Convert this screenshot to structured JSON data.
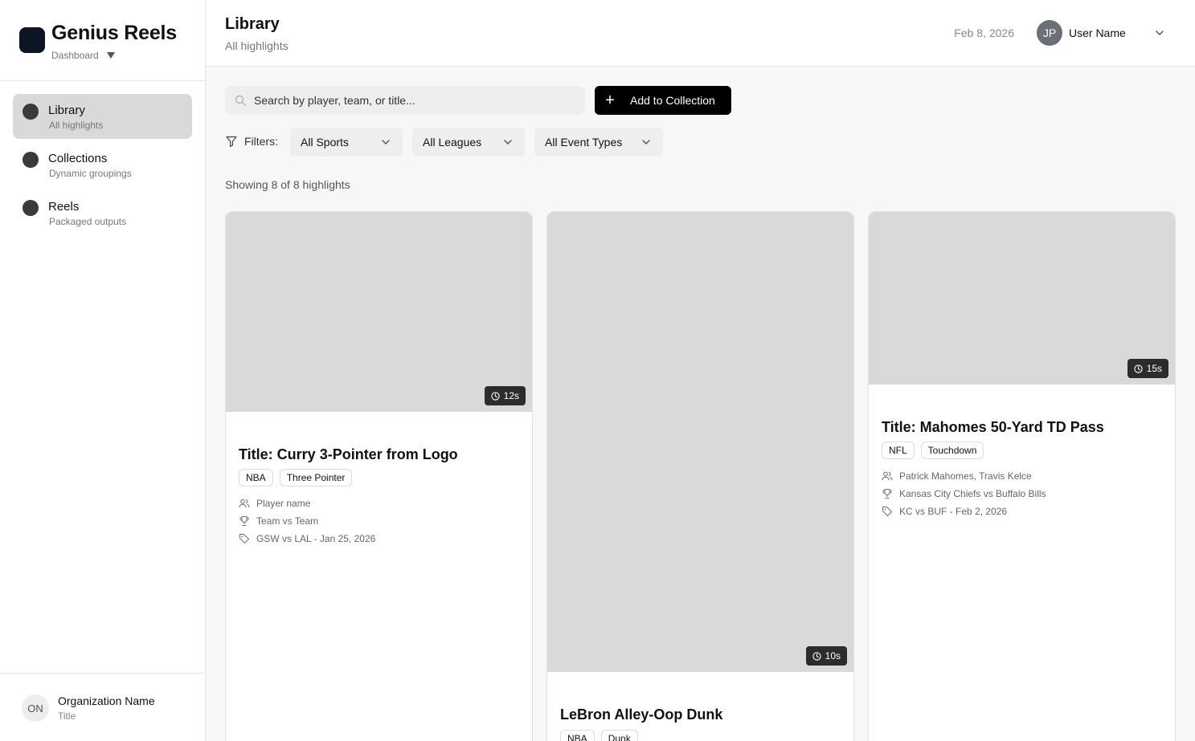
{
  "app": {
    "name": "Genius Reels",
    "context": "Dashboard"
  },
  "sidebar": {
    "items": [
      {
        "label": "Library",
        "sub": "All highlights"
      },
      {
        "label": "Collections",
        "sub": "Dynamic groupings"
      },
      {
        "label": "Reels",
        "sub": "Packaged outputs"
      }
    ],
    "org": {
      "initials": "ON",
      "name": "Organization Name",
      "title": "Title"
    }
  },
  "header": {
    "title": "Library",
    "subtitle": "All highlights",
    "date": "Feb 8, 2026",
    "user": {
      "initials": "JP",
      "name": "User Name"
    }
  },
  "toolbar": {
    "search_placeholder": "Search by player, team, or title...",
    "add_label": "Add to Collection",
    "filters_label": "Filters:",
    "filters": [
      "All Sports",
      "All Leagues",
      "All Event Types"
    ]
  },
  "results": {
    "count_text": "Showing 8 of 8 highlights"
  },
  "cards": [
    {
      "title": "Title: Curry 3-Pointer from Logo",
      "duration": "12s",
      "tags": [
        "NBA",
        "Three Pointer"
      ],
      "players": "Player name",
      "teams": "Team vs Team",
      "game": "GSW vs LAL - Jan 25, 2026"
    },
    {
      "title": "LeBron Alley-Oop Dunk",
      "duration": "10s",
      "tags": [
        "NBA",
        "Dunk"
      ]
    },
    {
      "title": "Title: Mahomes 50-Yard TD Pass",
      "duration": "15s",
      "tags": [
        "NFL",
        "Touchdown"
      ],
      "players": "Patrick Mahomes, Travis Kelce",
      "teams": "Kansas City Chiefs vs Buffalo Bills",
      "game": "KC vs BUF - Feb 2, 2026"
    }
  ]
}
